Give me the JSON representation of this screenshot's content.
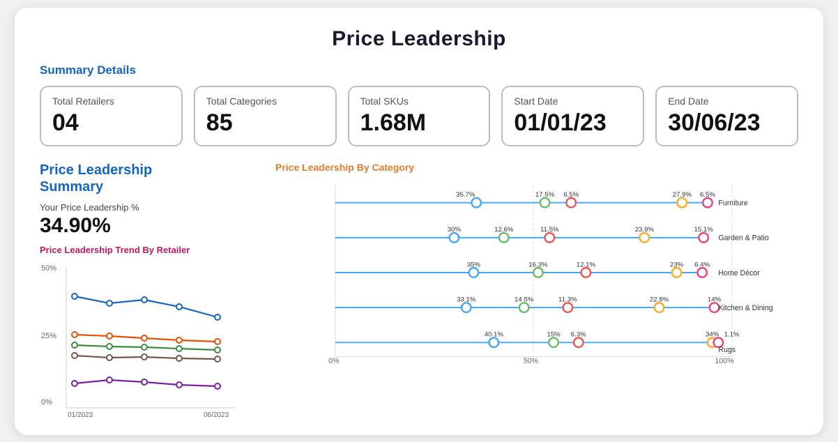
{
  "page": {
    "title": "Price Leadership"
  },
  "summary_section": {
    "label": "Summary Details",
    "cards": [
      {
        "label": "Total Retailers",
        "value": "04"
      },
      {
        "label": "Total Categories",
        "value": "85"
      },
      {
        "label": "Total SKUs",
        "value": "1.68M"
      },
      {
        "label": "Start Date",
        "value": "01/01/23"
      },
      {
        "label": "End Date",
        "value": "30/06/23"
      }
    ]
  },
  "pl_summary": {
    "title": "Price Leadership\nSummary",
    "pct_label": "Your Price Leadership %",
    "pct_value": "34.90%",
    "trend_title": "Price Leadership Trend By Retailer",
    "y_axis": [
      "50%",
      "25%",
      "0%"
    ],
    "x_axis": [
      "01/2023",
      "06/2023"
    ]
  },
  "category_chart": {
    "title": "Price Leadership By Category",
    "x_axis": [
      "0%",
      "50%",
      "100%"
    ],
    "categories": [
      {
        "name": "Furniture",
        "values": [
          35.7,
          17.5,
          6.5,
          27.9,
          6.5
        ],
        "labels": [
          "35.7%",
          "17.5%",
          "6.5%",
          "27.9%",
          "6.5%"
        ]
      },
      {
        "name": "Garden & Patio",
        "values": [
          30,
          12.6,
          11.5,
          23.9,
          15.1
        ],
        "labels": [
          "30%",
          "12.6%",
          "11.5%",
          "23.9%",
          "15.1%"
        ]
      },
      {
        "name": "Home Décor",
        "values": [
          35,
          16.3,
          12.1,
          23,
          6.4
        ],
        "labels": [
          "35%",
          "16.3%",
          "12.1%",
          "23%",
          "6.4%"
        ]
      },
      {
        "name": "Kitchen & Dining",
        "values": [
          33.1,
          14.5,
          11.3,
          22.8,
          14
        ],
        "labels": [
          "33.1%",
          "14.5%",
          "11.3%",
          "22.8%",
          "14%"
        ]
      },
      {
        "name": "Rugs",
        "values": [
          40.1,
          15,
          6.3,
          34,
          1.1
        ],
        "labels": [
          "40.1%",
          "15%",
          "6.3%",
          "34%",
          "1.1%"
        ]
      }
    ],
    "dot_colors": [
      "#42a5f5",
      "#66bb6a",
      "#ef5350",
      "#ffa726",
      "#ec407a"
    ]
  }
}
